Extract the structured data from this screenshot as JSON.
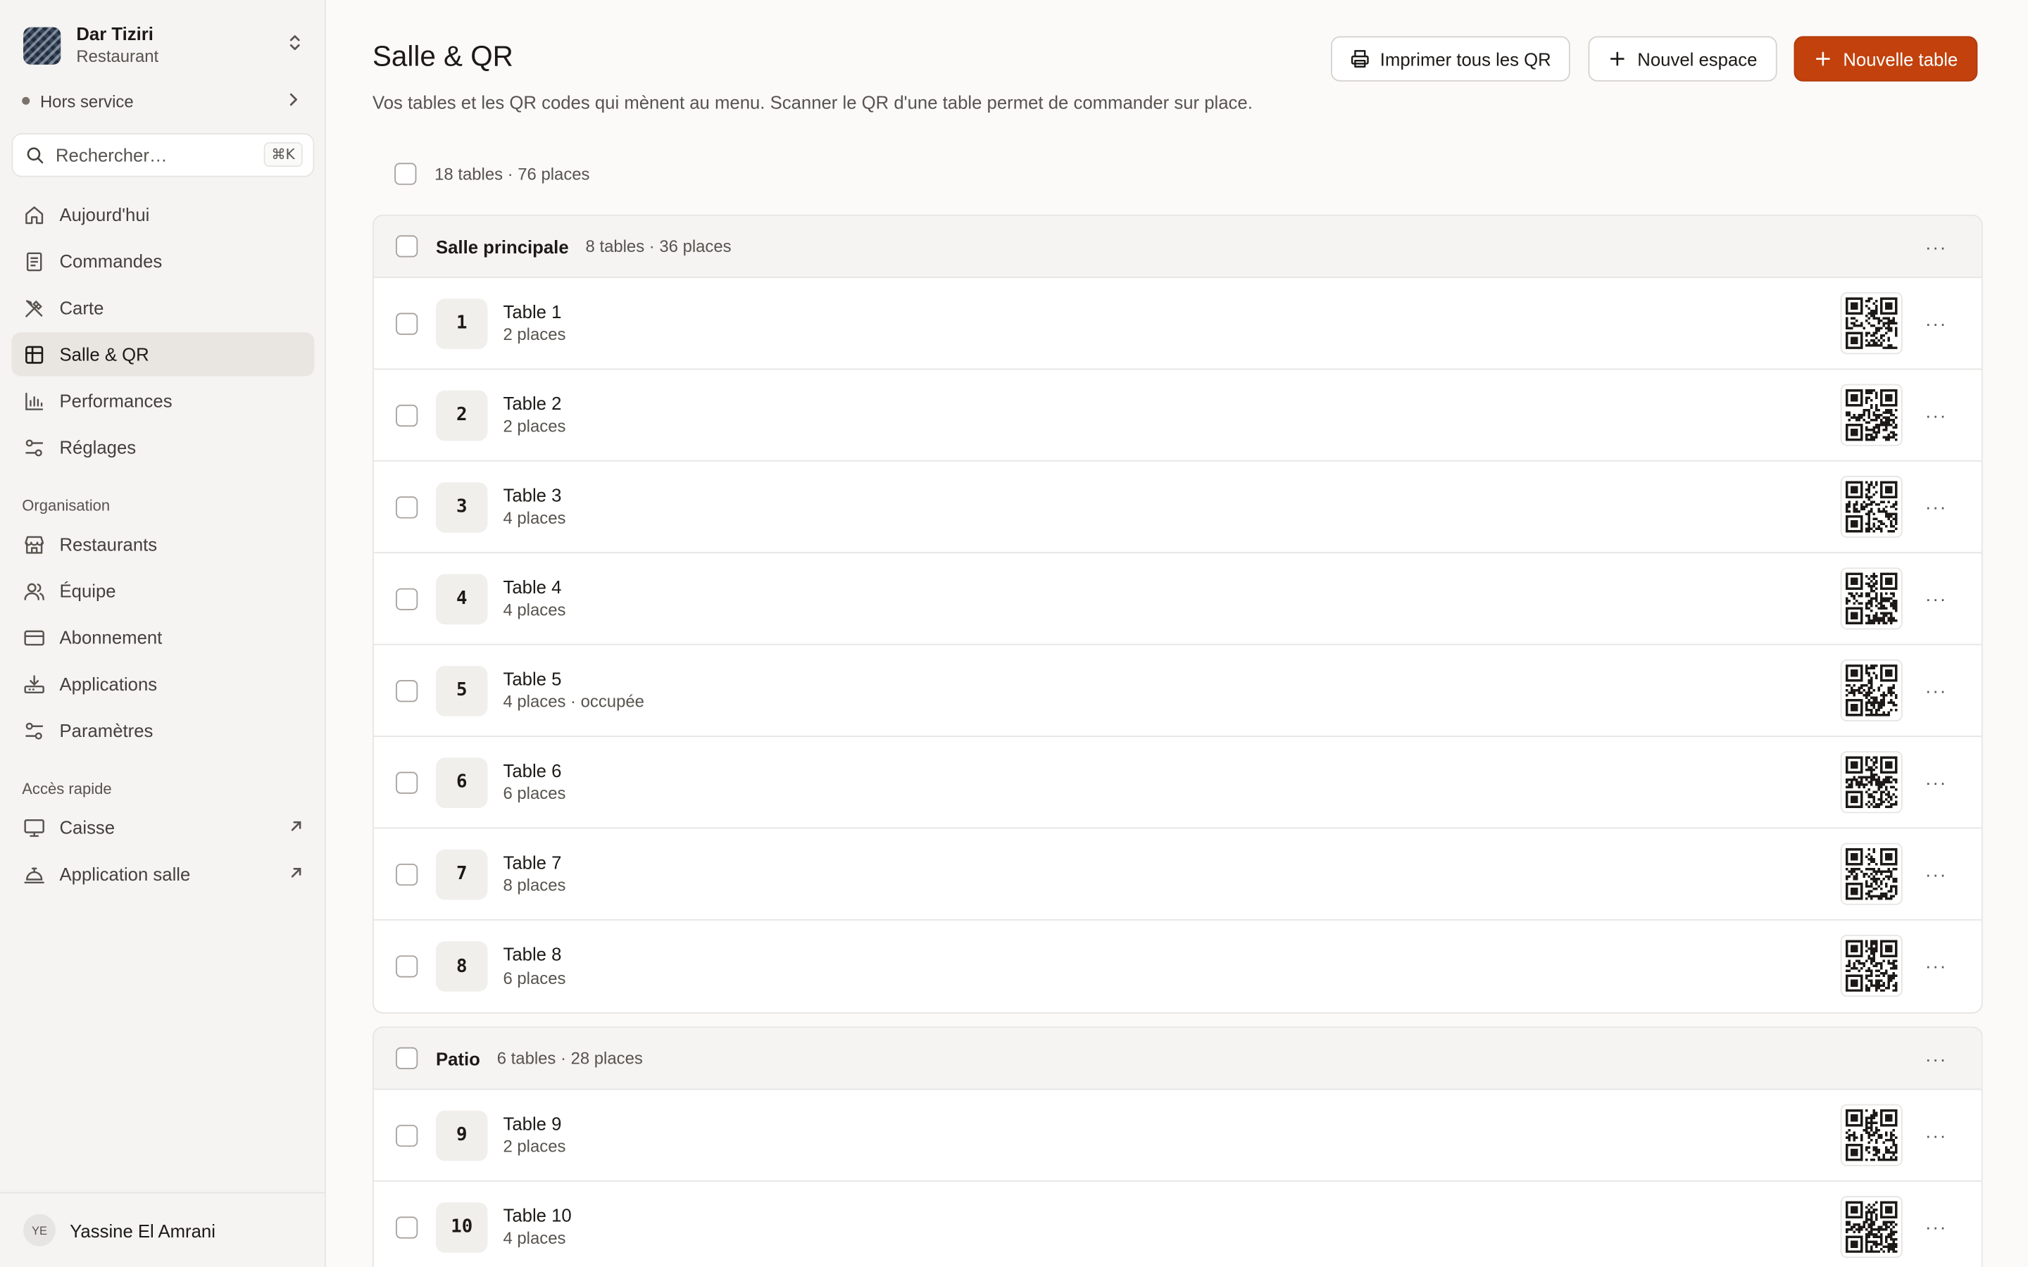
{
  "org": {
    "name": "Dar Tiziri",
    "type": "Restaurant"
  },
  "status": {
    "label": "Hors service"
  },
  "search": {
    "placeholder": "Rechercher…",
    "shortcut": "⌘K"
  },
  "nav": {
    "main": [
      {
        "label": "Aujourd'hui",
        "icon": "home-icon"
      },
      {
        "label": "Commandes",
        "icon": "receipt-icon"
      },
      {
        "label": "Carte",
        "icon": "utensils-icon"
      },
      {
        "label": "Salle & QR",
        "icon": "grid-icon",
        "active": true
      },
      {
        "label": "Performances",
        "icon": "bar-chart-icon"
      },
      {
        "label": "Réglages",
        "icon": "sliders-icon"
      }
    ],
    "org_section": "Organisation",
    "org": [
      {
        "label": "Restaurants",
        "icon": "store-icon"
      },
      {
        "label": "Équipe",
        "icon": "users-icon"
      },
      {
        "label": "Abonnement",
        "icon": "credit-card-icon"
      },
      {
        "label": "Applications",
        "icon": "apps-icon"
      },
      {
        "label": "Paramètres",
        "icon": "settings-sliders-icon"
      }
    ],
    "quick_section": "Accès rapide",
    "quick": [
      {
        "label": "Caisse",
        "icon": "monitor-icon"
      },
      {
        "label": "Application salle",
        "icon": "cloche-icon"
      }
    ]
  },
  "user": {
    "initials": "YE",
    "name": "Yassine El Amrani"
  },
  "page": {
    "title": "Salle & QR",
    "description": "Vos tables et les QR codes qui mènent au menu. Scanner le QR d'une table permet de commander sur place."
  },
  "actions": {
    "print_all": "Imprimer tous les QR",
    "new_space": "Nouvel espace",
    "new_table": "Nouvelle table"
  },
  "summary": "18 tables · 76 places",
  "groups": [
    {
      "name": "Salle principale",
      "meta": "8 tables · 36 places",
      "tables": [
        {
          "num": "1",
          "name": "Table 1",
          "meta": "2 places"
        },
        {
          "num": "2",
          "name": "Table 2",
          "meta": "2 places"
        },
        {
          "num": "3",
          "name": "Table 3",
          "meta": "4 places"
        },
        {
          "num": "4",
          "name": "Table 4",
          "meta": "4 places"
        },
        {
          "num": "5",
          "name": "Table 5",
          "meta": "4 places · occupée"
        },
        {
          "num": "6",
          "name": "Table 6",
          "meta": "6 places"
        },
        {
          "num": "7",
          "name": "Table 7",
          "meta": "8 places"
        },
        {
          "num": "8",
          "name": "Table 8",
          "meta": "6 places"
        }
      ]
    },
    {
      "name": "Patio",
      "meta": "6 tables · 28 places",
      "tables": [
        {
          "num": "9",
          "name": "Table 9",
          "meta": "2 places"
        },
        {
          "num": "10",
          "name": "Table 10",
          "meta": "4 places"
        }
      ]
    }
  ],
  "colors": {
    "accent": "#c2410c",
    "sidebar_bg": "#f5f4f2",
    "active_bg": "#e9e6e2"
  }
}
